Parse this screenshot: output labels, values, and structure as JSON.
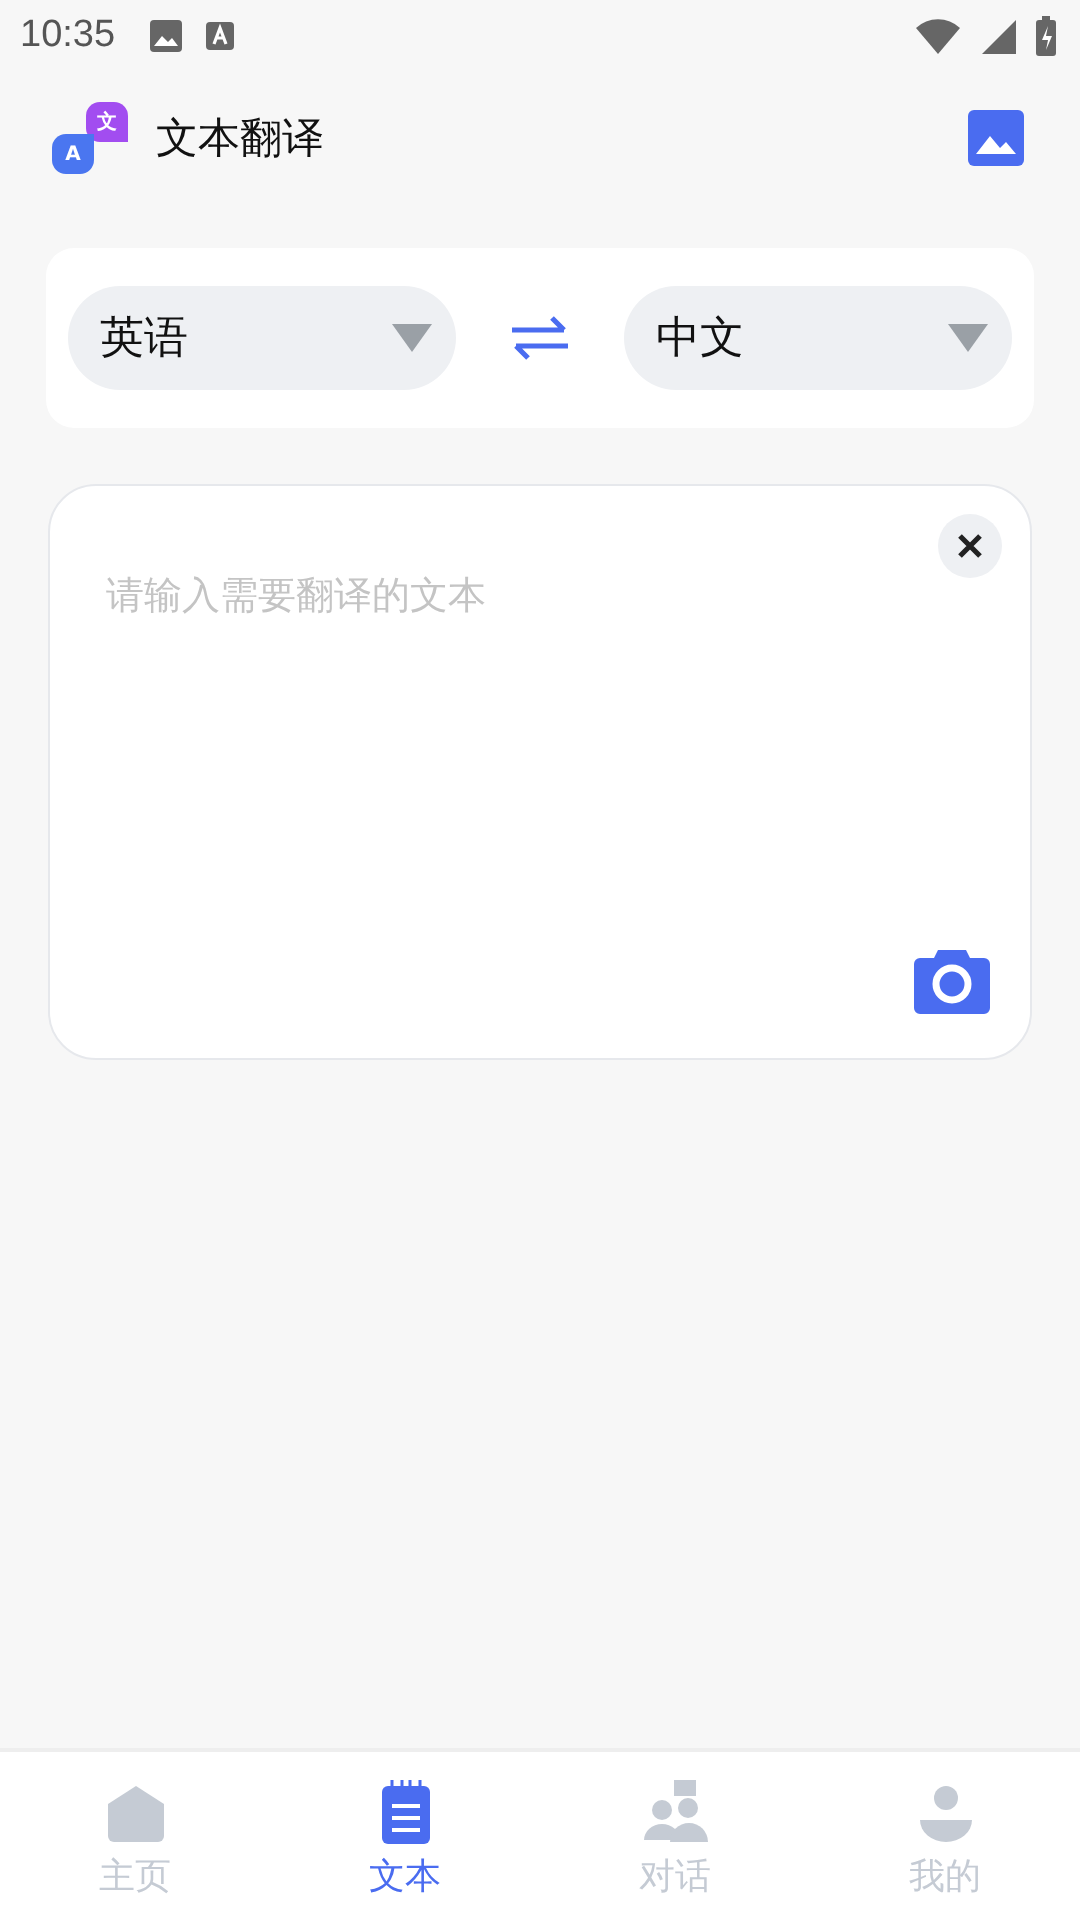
{
  "status_bar": {
    "time": "10:35"
  },
  "header": {
    "logo": {
      "back_letter": "A",
      "front_letter": "文"
    },
    "title": "文本翻译"
  },
  "languages": {
    "source": "英语",
    "target": "中文"
  },
  "input": {
    "placeholder": "请输入需要翻译的文本"
  },
  "bottom_nav": [
    {
      "label": "主页",
      "selected": false
    },
    {
      "label": "文本",
      "selected": true
    },
    {
      "label": "对话",
      "selected": false
    },
    {
      "label": "我的",
      "selected": false
    }
  ]
}
